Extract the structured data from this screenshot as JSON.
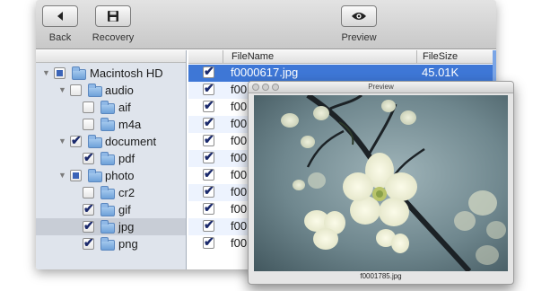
{
  "toolbar": {
    "back_label": "Back",
    "recovery_label": "Recovery",
    "preview_label": "Preview"
  },
  "tree": [
    {
      "label": "Macintosh HD",
      "state": "mixed",
      "expanded": true,
      "icon": "folder-icon"
    },
    {
      "label": "audio",
      "state": "unchecked",
      "expanded": true,
      "icon": "folder-icon"
    },
    {
      "label": "aif",
      "state": "unchecked",
      "icon": "folder-icon"
    },
    {
      "label": "m4a",
      "state": "unchecked",
      "icon": "folder-icon"
    },
    {
      "label": "document",
      "state": "checked",
      "expanded": true,
      "icon": "folder-icon"
    },
    {
      "label": "pdf",
      "state": "checked",
      "icon": "folder-icon"
    },
    {
      "label": "photo",
      "state": "mixed",
      "expanded": true,
      "icon": "folder-icon"
    },
    {
      "label": "cr2",
      "state": "unchecked",
      "icon": "folder-icon"
    },
    {
      "label": "gif",
      "state": "checked",
      "icon": "folder-icon"
    },
    {
      "label": "jpg",
      "state": "checked",
      "icon": "folder-icon",
      "selected": true
    },
    {
      "label": "png",
      "state": "checked",
      "icon": "folder-icon"
    }
  ],
  "list": {
    "columns": {
      "name": "FileName",
      "size": "FileSize"
    },
    "rows": [
      {
        "name": "f0000617.jpg",
        "size": "45.01K",
        "checked": true,
        "selected": true
      },
      {
        "name": "f00",
        "size": "",
        "checked": true
      },
      {
        "name": "f00",
        "size": "",
        "checked": true
      },
      {
        "name": "f00",
        "size": "",
        "checked": true
      },
      {
        "name": "f00",
        "size": "",
        "checked": true
      },
      {
        "name": "f00",
        "size": "",
        "checked": true
      },
      {
        "name": "f00",
        "size": "",
        "checked": true
      },
      {
        "name": "f00",
        "size": "",
        "checked": true
      },
      {
        "name": "f00",
        "size": "",
        "checked": true
      },
      {
        "name": "f00",
        "size": "",
        "checked": true
      },
      {
        "name": "f00",
        "size": "",
        "checked": true
      }
    ]
  },
  "preview": {
    "title": "Preview",
    "caption": "f0001785.jpg"
  },
  "colors": {
    "selection": "#3e77d6",
    "sidebar_bg": "#dfe4ec",
    "row_alt": "#edf3fe"
  }
}
